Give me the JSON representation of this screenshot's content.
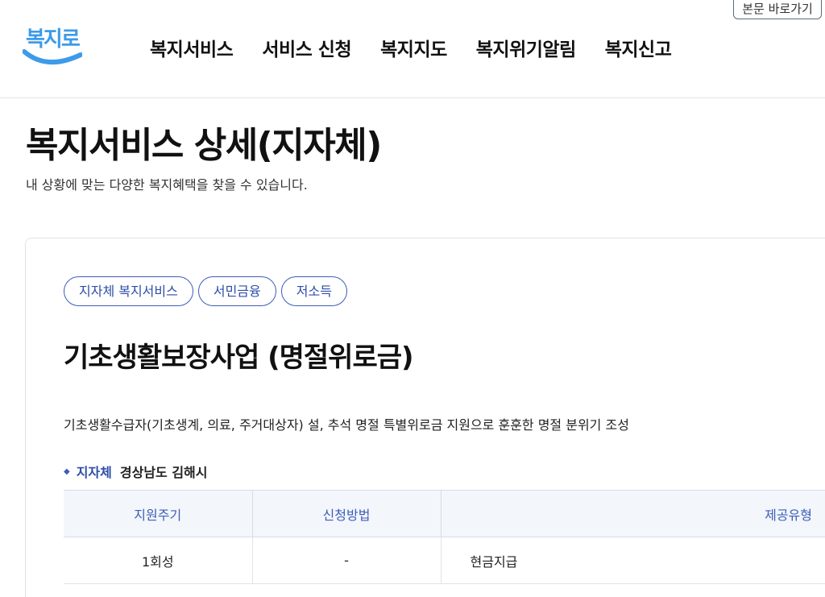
{
  "skip_link": "본문 바로가기",
  "logo": {
    "text": "복지로"
  },
  "nav": {
    "items": [
      "복지서비스",
      "서비스 신청",
      "복지지도",
      "복지위기알림",
      "복지신고"
    ]
  },
  "page": {
    "title": "복지서비스 상세(지자체)",
    "subtitle": "내 상황에 맞는 다양한 복지혜택을 찾을 수 있습니다."
  },
  "service": {
    "tags": [
      "지자체 복지서비스",
      "서민금융",
      "저소득"
    ],
    "title": "기초생활보장사업 (명절위로금)",
    "description": "기초생활수급자(기초생계, 의료, 주거대상자) 설, 추석 명절 특별위로금 지원으로 훈훈한 명절 분위기 조성",
    "region_label": "지자체",
    "region_value": "경상남도 김해시",
    "table": {
      "headers": [
        "지원주기",
        "신청방법",
        "제공유형"
      ],
      "rows": [
        [
          "1회성",
          "-",
          "현금지급"
        ]
      ]
    }
  },
  "colors": {
    "accent": "#3d5db8",
    "logo_blue": "#3d9be9",
    "table_header_bg": "#f3f6fb"
  }
}
